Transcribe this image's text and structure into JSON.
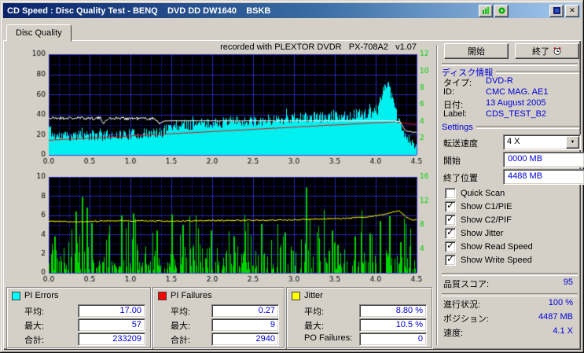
{
  "titlebar": {
    "title": "CD Speed : Disc Quality Test - BENQ    DVD DD DW1640    BSKB"
  },
  "tab": {
    "label": "Disc Quality"
  },
  "chart_header": "recorded with PLEXTOR DVDR   PX-708A2   v1.07",
  "buttons": {
    "start": "開始",
    "exit": "終了"
  },
  "disc_info": {
    "header": "ディスク情報",
    "rows": [
      {
        "label": "タイプ:",
        "value": "DVD-R"
      },
      {
        "label": "ID:",
        "value": "CMC MAG. AE1"
      },
      {
        "label": "日付:",
        "value": "13 August 2005"
      },
      {
        "label": "Label:",
        "value": "CDS_TEST_B2"
      }
    ]
  },
  "settings": {
    "header": "Settings",
    "speed": {
      "label": "転送速度",
      "value": "4 X"
    },
    "start": {
      "label": "開始",
      "value": "0000 MB"
    },
    "end": {
      "label": "終了位置",
      "value": "4488 MB"
    },
    "checkboxes": [
      {
        "label": "Quick Scan",
        "checked": false
      },
      {
        "label": "Show C1/PIE",
        "checked": true
      },
      {
        "label": "Show C2/PIF",
        "checked": true
      },
      {
        "label": "Show Jitter",
        "checked": true
      },
      {
        "label": "Show Read Speed",
        "checked": true
      },
      {
        "label": "Show Write Speed",
        "checked": true
      }
    ]
  },
  "score": {
    "label": "品質スコア:",
    "value": "95"
  },
  "status": {
    "progress": {
      "label": "進行状況:",
      "value": "100 %"
    },
    "position": {
      "label": "ポジション:",
      "value": "4487 MB"
    },
    "speed": {
      "label": "速度:",
      "value": "4.1 X"
    }
  },
  "stats": {
    "pi_errors": {
      "title": "PI Errors",
      "color": "#00ffff",
      "rows": [
        {
          "label": "平均:",
          "value": "17.00"
        },
        {
          "label": "最大:",
          "value": "57"
        },
        {
          "label": "合計:",
          "value": "233209"
        }
      ]
    },
    "pi_failures": {
      "title": "PI Failures",
      "color": "#ff0000",
      "rows": [
        {
          "label": "平均:",
          "value": "0.27"
        },
        {
          "label": "最大:",
          "value": "9"
        },
        {
          "label": "合計:",
          "value": "2940"
        }
      ]
    },
    "jitter": {
      "title": "Jitter",
      "color": "#ffff00",
      "rows": [
        {
          "label": "平均:",
          "value": "8.80 %"
        },
        {
          "label": "最大:",
          "value": "10.5 %"
        },
        {
          "label": "PO Failures:",
          "value": "0"
        }
      ]
    }
  },
  "chart_data": [
    {
      "type": "area",
      "name": "pi-errors-scan",
      "x_range": [
        0,
        4.5
      ],
      "x_ticks": [
        0,
        0.5,
        1,
        1.5,
        2,
        2.5,
        3,
        3.5,
        4,
        4.5
      ],
      "left_axis": {
        "range": [
          0,
          100
        ],
        "ticks": [
          0,
          20,
          40,
          60,
          80,
          100
        ]
      },
      "right_axis": {
        "range": [
          0,
          12
        ],
        "ticks": [
          2,
          4,
          6,
          8,
          10,
          12
        ],
        "color": "#00cc00",
        "unit": "X"
      },
      "series": [
        {
          "name": "PI Errors",
          "style": "bars",
          "color": "#00f0f0",
          "seed": 11,
          "noise": 5.5,
          "envelope": [
            [
              0,
              28
            ],
            [
              0.05,
              19
            ],
            [
              0.4,
              19
            ],
            [
              0.8,
              20
            ],
            [
              1.2,
              21
            ],
            [
              1.38,
              22
            ],
            [
              1.48,
              29
            ],
            [
              1.9,
              31
            ],
            [
              2.3,
              33
            ],
            [
              2.7,
              35
            ],
            [
              3.1,
              37
            ],
            [
              3.5,
              38
            ],
            [
              3.9,
              41
            ],
            [
              4.02,
              45
            ],
            [
              4.08,
              64
            ],
            [
              4.13,
              72
            ],
            [
              4.18,
              62
            ],
            [
              4.25,
              40
            ],
            [
              4.32,
              24
            ],
            [
              4.45,
              10
            ]
          ]
        },
        {
          "name": "Write Speed",
          "style": "line",
          "color": "#e81010",
          "seed": 31,
          "width": 1,
          "noise": 0.25,
          "envelope": [
            [
              0,
              14.5
            ],
            [
              4.25,
              33
            ],
            [
              4.33,
              31.5
            ],
            [
              4.45,
              30.5
            ]
          ]
        },
        {
          "name": "Read Speed",
          "style": "line",
          "color": "#ffffff",
          "seed": 21,
          "width": 1,
          "noise_segments": [
            [
              0,
              1.36,
              1.6
            ],
            [
              1.42,
              4.5,
              0.25
            ]
          ],
          "envelope": [
            [
              0,
              36.5
            ],
            [
              0.63,
              36.5
            ],
            [
              0.68,
              31.5
            ],
            [
              0.73,
              36.5
            ],
            [
              1.3,
              36
            ],
            [
              1.36,
              31.5
            ],
            [
              1.42,
              33.8
            ],
            [
              4.2,
              33.8
            ],
            [
              4.3,
              33
            ],
            [
              4.36,
              24
            ],
            [
              4.45,
              22.5
            ]
          ]
        }
      ]
    },
    {
      "type": "bars+line",
      "name": "pi-failures-jitter-scan",
      "x_range": [
        0,
        4.5
      ],
      "x_ticks": [
        0,
        0.5,
        1,
        1.5,
        2,
        2.5,
        3,
        3.5,
        4,
        4.5
      ],
      "left_axis": {
        "range": [
          0,
          10
        ],
        "ticks": [
          0,
          2,
          4,
          6,
          8,
          10
        ]
      },
      "right_axis": {
        "range": [
          0,
          16
        ],
        "ticks": [
          4,
          8,
          12,
          16
        ],
        "color": "#00cc00",
        "unit": "X"
      },
      "series": [
        {
          "name": "PI Failures",
          "style": "bars",
          "color": "#00d400",
          "seed": 5,
          "distribution": true,
          "spikes": [
            [
              0.07,
              3.8
            ],
            [
              0.33,
              6.4
            ],
            [
              0.4,
              7.9
            ],
            [
              0.46,
              6.8
            ],
            [
              0.52,
              5.2
            ],
            [
              0.88,
              6.0
            ],
            [
              1.03,
              6.2
            ],
            [
              1.32,
              4.4
            ],
            [
              1.5,
              6.1
            ],
            [
              1.63,
              5.0
            ],
            [
              1.98,
              4.4
            ],
            [
              2.26,
              3.8
            ],
            [
              2.6,
              5.1
            ],
            [
              2.88,
              4.2
            ],
            [
              3.14,
              8.9
            ],
            [
              3.3,
              3.6
            ],
            [
              3.46,
              4.4
            ],
            [
              3.74,
              3.8
            ],
            [
              3.92,
              4.1
            ],
            [
              4.05,
              5.4
            ],
            [
              4.16,
              5.9
            ],
            [
              4.3,
              3.2
            ]
          ]
        },
        {
          "name": "Jitter",
          "style": "line",
          "axis": "right",
          "color": "#ffff00",
          "seed": 9,
          "width": 1,
          "noise": 0.12,
          "envelope": [
            [
              0,
              8.6
            ],
            [
              0.4,
              8.5
            ],
            [
              0.9,
              8.7
            ],
            [
              1.4,
              8.6
            ],
            [
              1.9,
              8.7
            ],
            [
              2.4,
              8.75
            ],
            [
              2.9,
              8.8
            ],
            [
              3.4,
              9.0
            ],
            [
              3.7,
              9.1
            ],
            [
              3.95,
              9.4
            ],
            [
              4.15,
              9.9
            ],
            [
              4.28,
              10.4
            ],
            [
              4.38,
              9.2
            ],
            [
              4.45,
              8.8
            ]
          ]
        }
      ]
    }
  ]
}
